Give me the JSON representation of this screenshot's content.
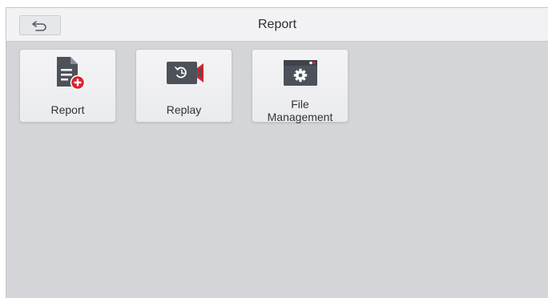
{
  "header": {
    "title": "Report",
    "back_icon": "back-arrow-icon"
  },
  "tiles": [
    {
      "label": "Report",
      "icon": "report-add-icon"
    },
    {
      "label": "Replay",
      "icon": "replay-video-icon"
    },
    {
      "label_line1": "File",
      "label_line2": "Management",
      "icon": "folder-settings-icon"
    }
  ],
  "colors": {
    "icon_dark": "#4d5159",
    "icon_accent": "#d9232f",
    "background": "#d3d5d9",
    "topbar": "#f2f2f4"
  }
}
